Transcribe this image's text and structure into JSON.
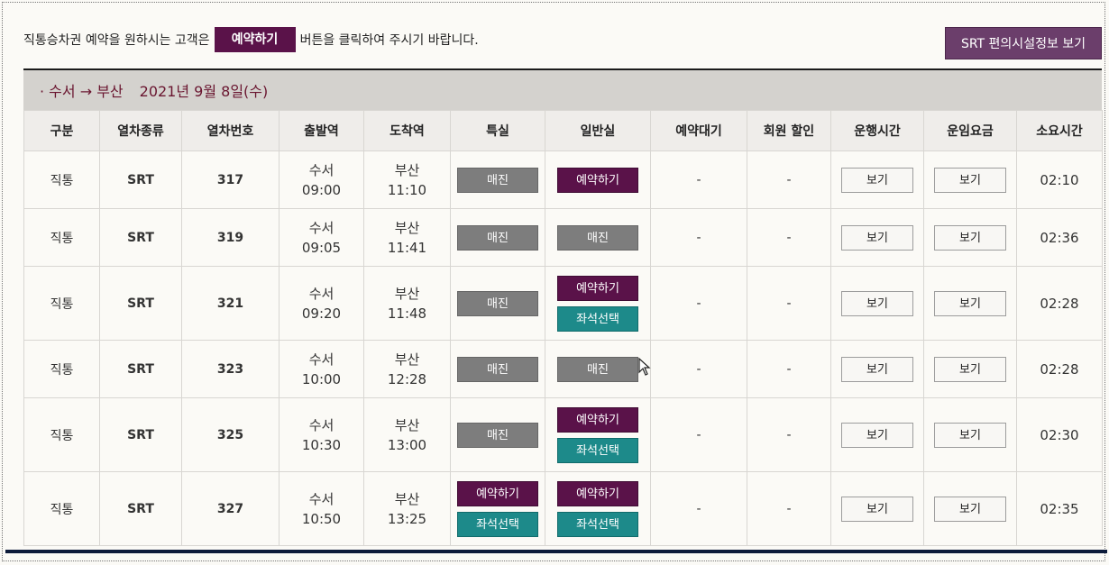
{
  "intro": {
    "before": "직통승차권 예약을 원하시는 고객은",
    "button": "예약하기",
    "after": "버튼을 클릭하여 주시기 바랍니다."
  },
  "facility_button": "SRT 편의시설정보 보기",
  "route": {
    "title": "· 수서 → 부산",
    "date": "2021년 9월 8일(수)"
  },
  "headers": [
    "구분",
    "열차종류",
    "열차번호",
    "출발역",
    "도착역",
    "특실",
    "일반실",
    "예약대기",
    "회원 할인",
    "운행시간",
    "운임요금",
    "소요시간"
  ],
  "rows": [
    {
      "type": "직통",
      "train": "SRT",
      "no": "317",
      "dep_st": "수서",
      "dep_time": "09:00",
      "arr_st": "부산",
      "arr_time": "11:10",
      "first": [
        "매진"
      ],
      "general": [
        "예약하기"
      ],
      "wait": "-",
      "discount": "-",
      "op": "보기",
      "fare": "보기",
      "dur": "02:10"
    },
    {
      "type": "직통",
      "train": "SRT",
      "no": "319",
      "dep_st": "수서",
      "dep_time": "09:05",
      "arr_st": "부산",
      "arr_time": "11:41",
      "first": [
        "매진"
      ],
      "general": [
        "매진"
      ],
      "wait": "-",
      "discount": "-",
      "op": "보기",
      "fare": "보기",
      "dur": "02:36"
    },
    {
      "type": "직통",
      "train": "SRT",
      "no": "321",
      "dep_st": "수서",
      "dep_time": "09:20",
      "arr_st": "부산",
      "arr_time": "11:48",
      "first": [
        "매진"
      ],
      "general": [
        "예약하기",
        "좌석선택"
      ],
      "wait": "-",
      "discount": "-",
      "op": "보기",
      "fare": "보기",
      "dur": "02:28"
    },
    {
      "type": "직통",
      "train": "SRT",
      "no": "323",
      "dep_st": "수서",
      "dep_time": "10:00",
      "arr_st": "부산",
      "arr_time": "12:28",
      "first": [
        "매진"
      ],
      "general": [
        "매진"
      ],
      "wait": "-",
      "discount": "-",
      "op": "보기",
      "fare": "보기",
      "dur": "02:28"
    },
    {
      "type": "직통",
      "train": "SRT",
      "no": "325",
      "dep_st": "수서",
      "dep_time": "10:30",
      "arr_st": "부산",
      "arr_time": "13:00",
      "first": [
        "매진"
      ],
      "general": [
        "예약하기",
        "좌석선택"
      ],
      "wait": "-",
      "discount": "-",
      "op": "보기",
      "fare": "보기",
      "dur": "02:30"
    },
    {
      "type": "직통",
      "train": "SRT",
      "no": "327",
      "dep_st": "수서",
      "dep_time": "10:50",
      "arr_st": "부산",
      "arr_time": "13:25",
      "first": [
        "예약하기",
        "좌석선택"
      ],
      "general": [
        "예약하기",
        "좌석선택"
      ],
      "wait": "-",
      "discount": "-",
      "op": "보기",
      "fare": "보기",
      "dur": "02:35"
    }
  ],
  "colors": {
    "reserve": "#5a1249",
    "seat_select": "#1d8a8a",
    "sold_out": "#7d7d7d",
    "route_text": "#6a1630"
  }
}
